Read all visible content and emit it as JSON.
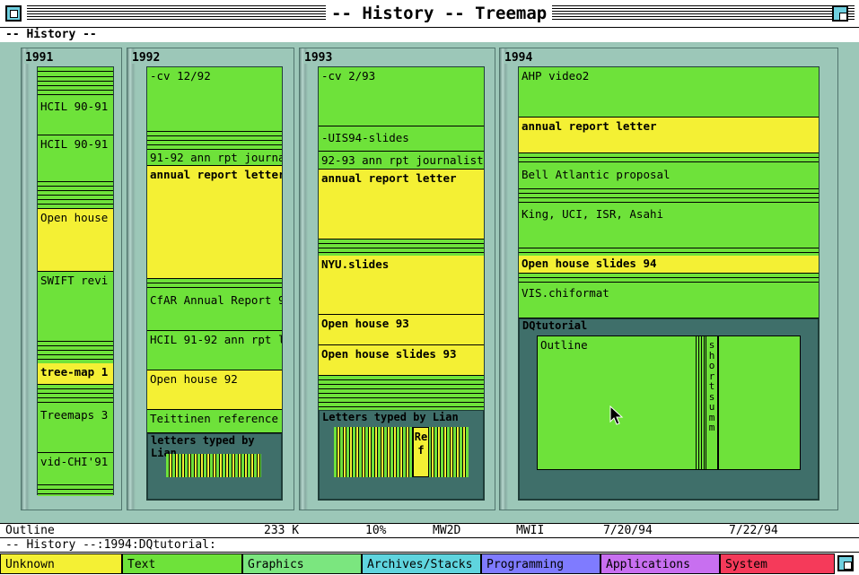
{
  "window": {
    "title": "-- History -- Treemap",
    "subtitle": "-- History --"
  },
  "treemap": {
    "years": [
      "1991",
      "1992",
      "1993",
      "1994"
    ],
    "y1991": {
      "items": [
        "HCIL 90-91",
        "HCIL 90-91",
        "Open house",
        "SWIFT revi",
        "tree-map 1",
        "Treemaps 3",
        "vid-CHI'91"
      ]
    },
    "y1992": {
      "items": [
        "-cv  12/92",
        "91-92 ann rpt journa",
        "annual report letter",
        "CfAR Annual Report 9",
        "HCIL 91-92 ann rpt le",
        "Open house 92",
        "Teittinen reference"
      ],
      "folder": "letters typed by Lian"
    },
    "y1993": {
      "items": [
        "-cv  2/93",
        "-UIS94-slides",
        "92-93 ann rpt journalists",
        "annual report letter",
        "NYU.slides",
        "Open house 93",
        "Open house slides 93"
      ],
      "folder": "Letters typed by Lian",
      "folder_item": "Ref"
    },
    "y1994": {
      "items": [
        "AHP video2",
        "annual report letter",
        "Bell Atlantic proposal",
        "King, UCI, ISR, Asahi",
        "Open house slides 94",
        "VIS.chiformat"
      ],
      "folder": "DQtutorial",
      "folder_items": [
        "Outline",
        "short summ"
      ]
    }
  },
  "status": {
    "name": "Outline",
    "size": "233 K",
    "percent": "10%",
    "creator": "MW2D",
    "type": "MWII",
    "created": "7/20/94",
    "modified": "7/22/94"
  },
  "path": "-- History --:1994:DQtutorial:",
  "legend": {
    "items": [
      {
        "label": "Unknown",
        "color": "#f4f034"
      },
      {
        "label": "Text",
        "color": "#6ee23a"
      },
      {
        "label": "Graphics",
        "color": "#7be67f"
      },
      {
        "label": "Archives/Stacks",
        "color": "#5fd4de"
      },
      {
        "label": "Programming",
        "color": "#7f7bff"
      },
      {
        "label": "Applications",
        "color": "#c86ff0"
      },
      {
        "label": "System",
        "color": "#f53a5a"
      }
    ]
  }
}
